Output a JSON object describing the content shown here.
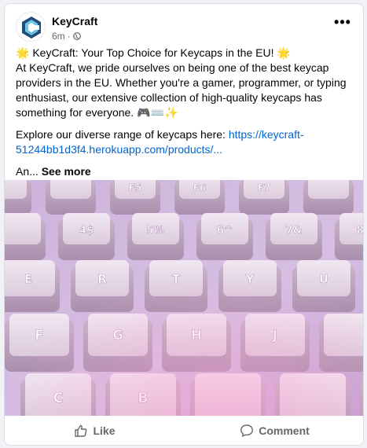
{
  "post": {
    "page_name": "KeyCraft",
    "time": "6m",
    "dot": "·",
    "more_label": "•••",
    "headline": "🌟 KeyCraft: Your Top Choice for Keycaps in the EU! 🌟",
    "paragraph": "At KeyCraft, we pride ourselves on being one of the best keycap providers in the EU. Whether you're a gamer, programmer, or typing enthusiast, our extensive collection of high-quality keycaps has something for everyone. 🎮⌨️✨",
    "explore_prefix": "Explore our diverse range of keycaps here: ",
    "explore_link": "https://keycraft-51244bb1d3f4.herokuapp.com/products/...",
    "truncated": "An...",
    "see_more": "See more"
  },
  "photo": {
    "key_legends": [
      "F5",
      "F6",
      "F7",
      "4$",
      "5%",
      "6^",
      "7&",
      "8*",
      "E",
      "R",
      "T",
      "Y",
      "U",
      "I",
      "F",
      "G",
      "H",
      "J",
      "C",
      "B"
    ]
  },
  "actions": {
    "like_label": "Like",
    "comment_label": "Comment"
  },
  "colors": {
    "link": "#0064d1",
    "meta_text": "#65676b",
    "keycap_body": "#e9dce8",
    "background_glow": "#c8a8d8"
  }
}
